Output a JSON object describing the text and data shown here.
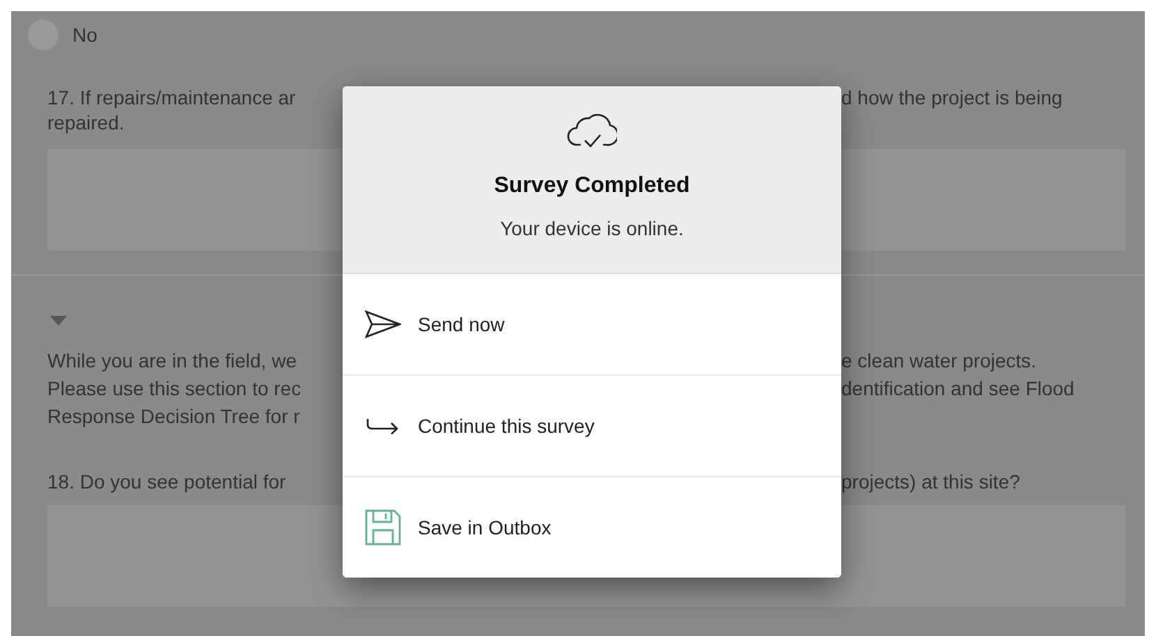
{
  "form": {
    "radio_option": {
      "label": "No",
      "selected": false
    },
    "question_17": {
      "line_1_left": "17. If repairs/maintenance ar",
      "line_1_right": "d how the project is being",
      "line_2": "repaired."
    },
    "section": {
      "expanded": true,
      "lines": [
        {
          "left": "While you are in the field, we",
          "right": "e clean water projects."
        },
        {
          "left": "Please use this section to rec",
          "right": "dentification and see Flood"
        },
        {
          "left": "Response Decision Tree for r"
        }
      ]
    },
    "question_18": {
      "left": "18. Do you see potential for",
      "right": "projects) at this site?"
    }
  },
  "dialog": {
    "title": "Survey Completed",
    "message": "Your device is online.",
    "actions": [
      {
        "kind": "send",
        "label": "Send now"
      },
      {
        "kind": "continue",
        "label": "Continue this survey"
      },
      {
        "kind": "save",
        "label": "Save in Outbox"
      }
    ]
  }
}
